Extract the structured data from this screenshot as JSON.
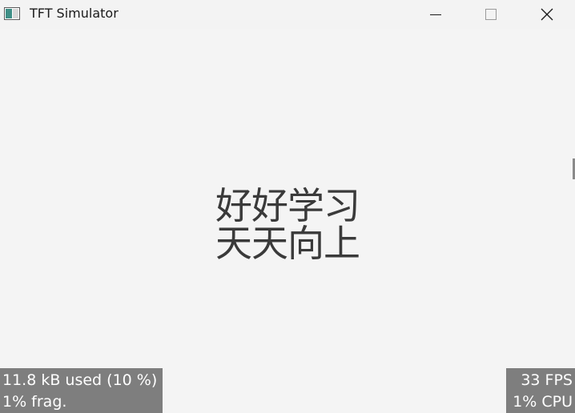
{
  "window": {
    "title": "TFT Simulator",
    "icon": "app-window-icon",
    "controls": {
      "minimize_icon": "minimize-icon",
      "maximize_icon": "maximize-icon",
      "close_icon": "close-icon"
    }
  },
  "content": {
    "line1": "好好学习",
    "line2": "天天向上"
  },
  "stats": {
    "memory_used": "11.8 kB used (10 %)",
    "fragmentation": "1% frag.",
    "fps": "33 FPS",
    "cpu": "1% CPU"
  },
  "colors": {
    "background": "#f4f4f4",
    "overlay": "#7e7e7e",
    "overlay_text": "#ffffff",
    "text": "#3a3a3a"
  }
}
